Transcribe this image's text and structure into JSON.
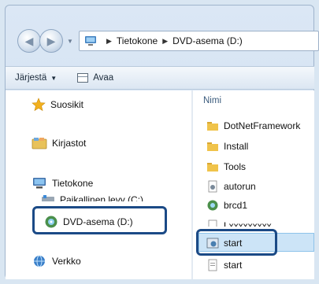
{
  "address": {
    "crumbs": [
      "Tietokone",
      "DVD-asema (D:)"
    ]
  },
  "toolbar": {
    "organize_label": "Järjestä",
    "open_label": "Avaa"
  },
  "nav": {
    "favorites": "Suosikit",
    "libraries": "Kirjastot",
    "computer": "Tietokone",
    "local_disk": "Paikallinen levy (C:)",
    "dvd_drive": "DVD-asema (D:)",
    "network": "Verkko"
  },
  "content": {
    "column_name": "Nimi",
    "files": [
      {
        "name": "DotNetFramework",
        "icon": "folder-icon"
      },
      {
        "name": "Install",
        "icon": "folder-icon"
      },
      {
        "name": "Tools",
        "icon": "folder-icon"
      },
      {
        "name": "autorun",
        "icon": "settings-file-icon"
      },
      {
        "name": "brcd1",
        "icon": "cd-setup-icon"
      },
      {
        "name": "Lxxxxxxxxx",
        "icon": "document-icon"
      },
      {
        "name": "start",
        "icon": "application-icon"
      },
      {
        "name": "start",
        "icon": "document-icon"
      }
    ]
  },
  "colors": {
    "highlight_border": "#1b4a86",
    "selection_bg": "#cce4f7",
    "header_text": "#3a5a7c"
  }
}
